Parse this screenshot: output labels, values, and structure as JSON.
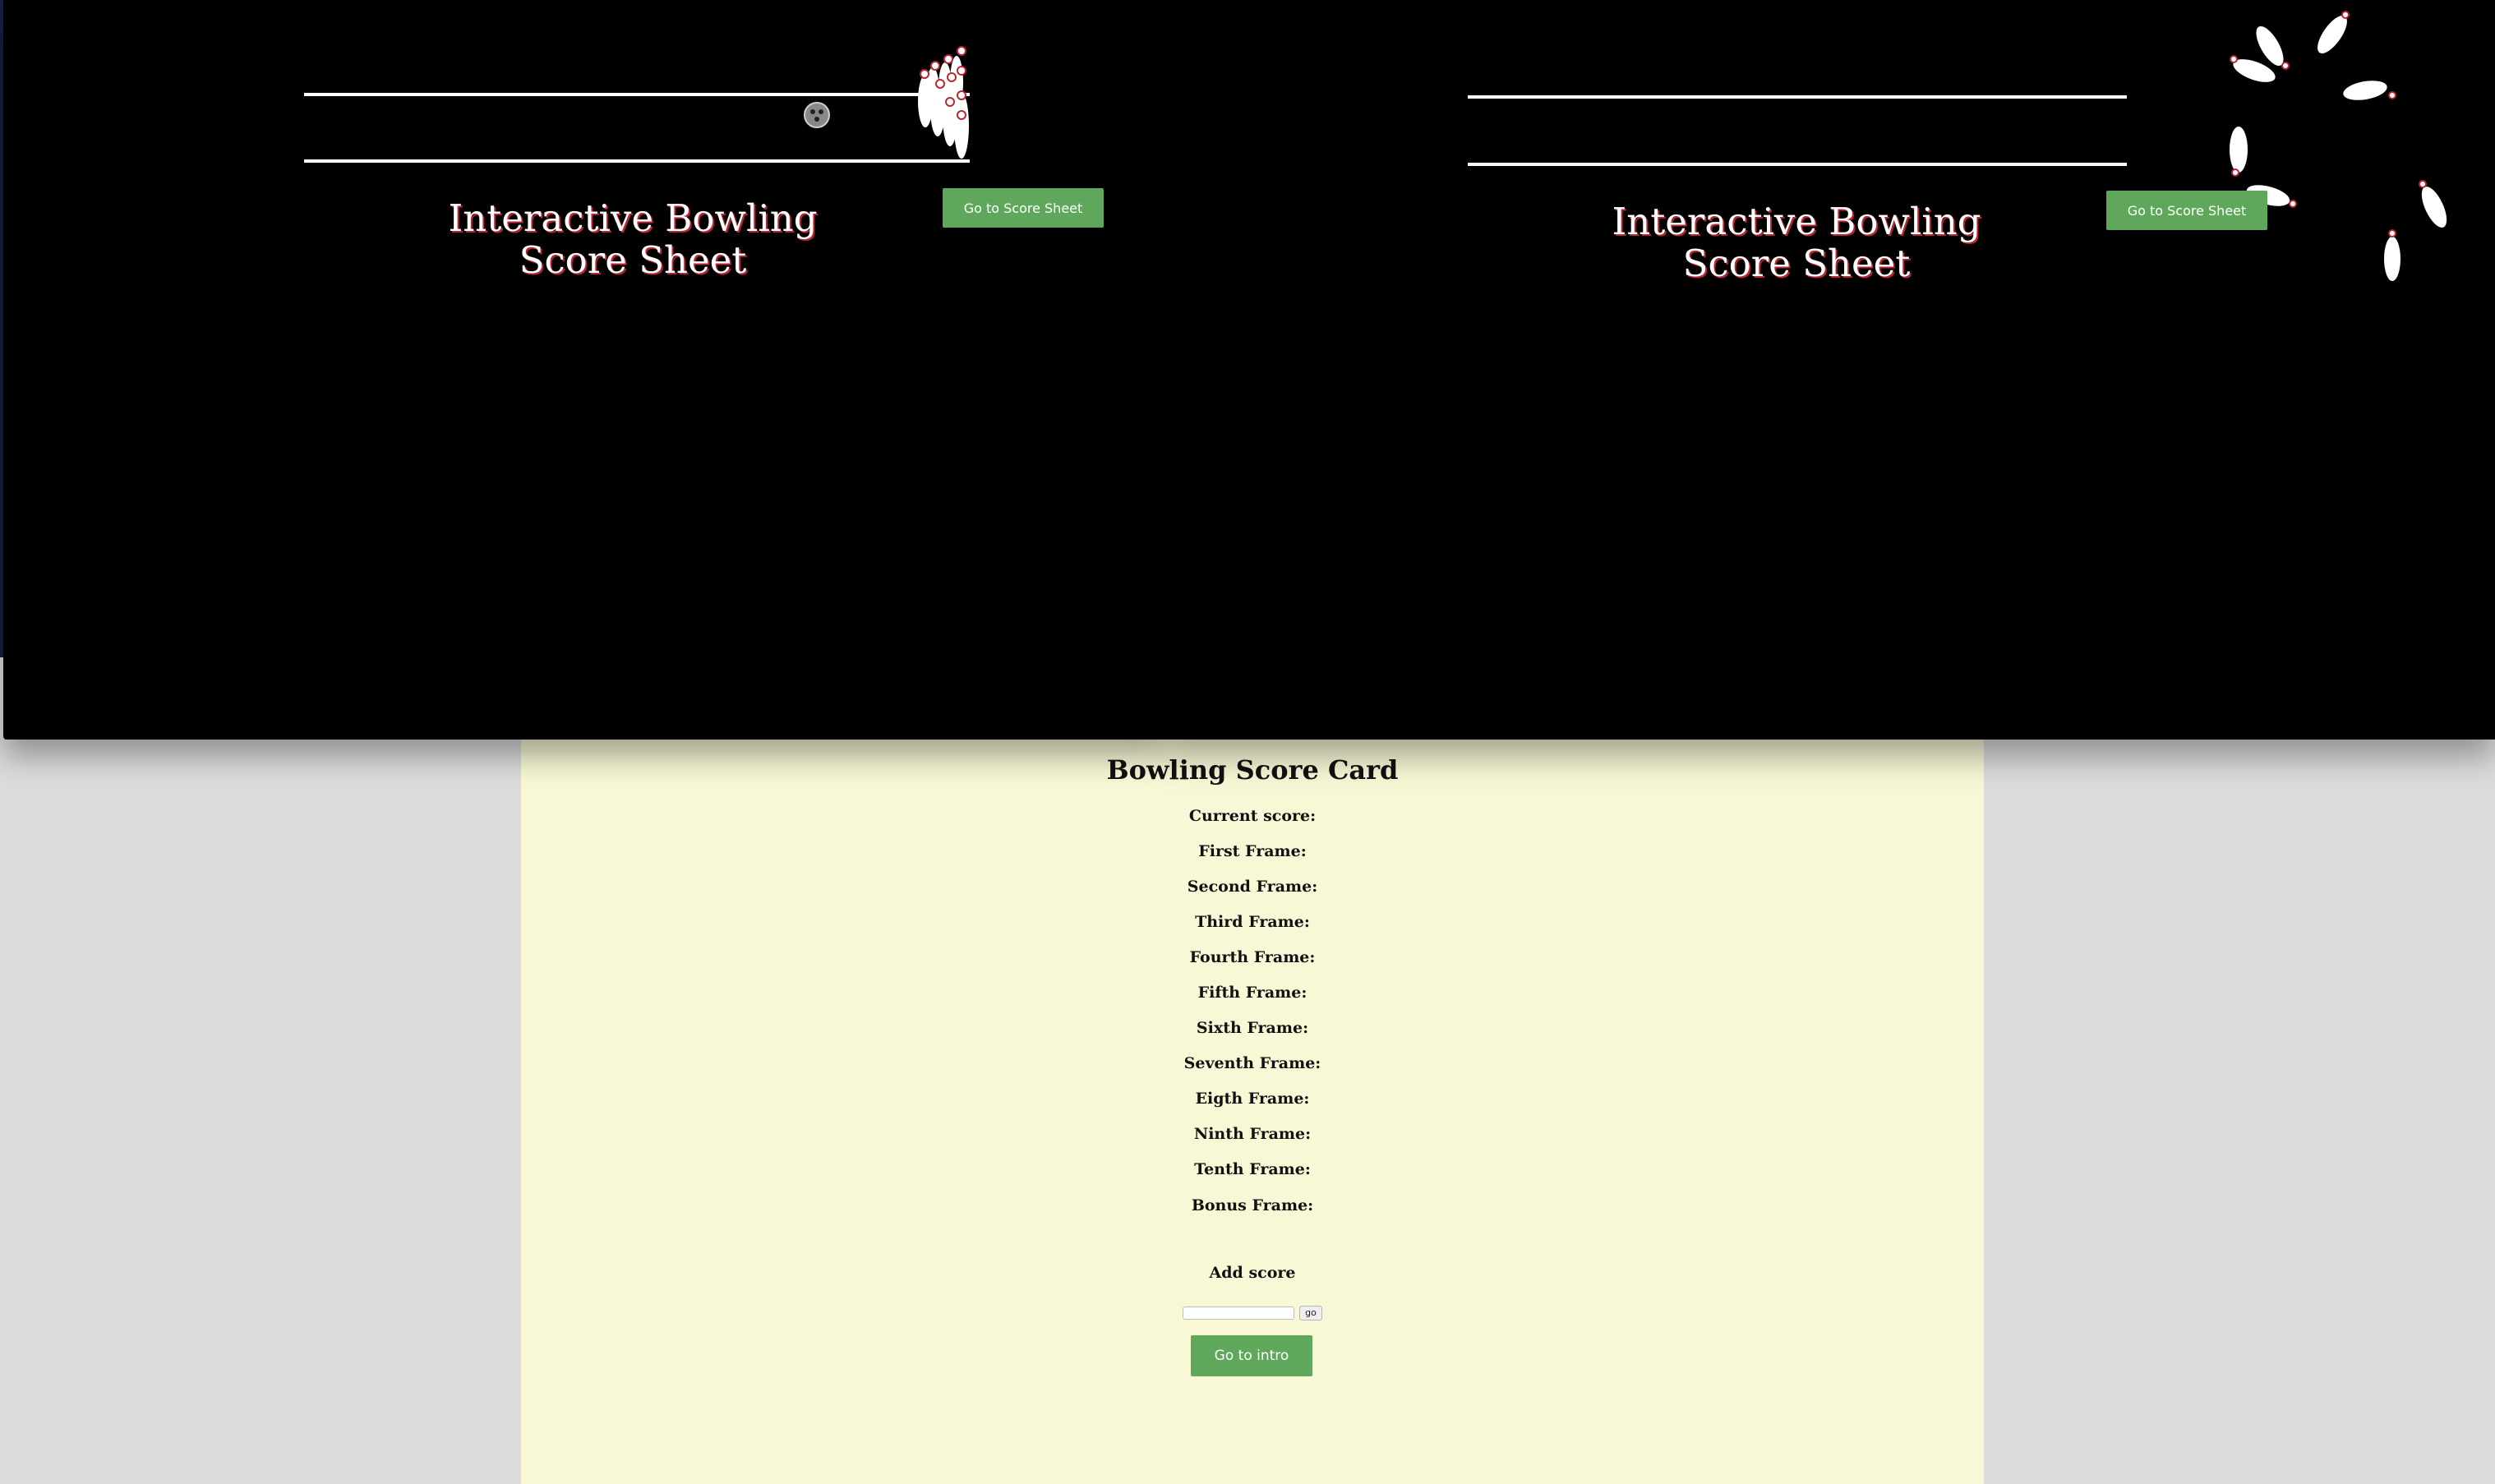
{
  "intro": {
    "title_line1": "Interactive Bowling",
    "title_line2": "Score Sheet",
    "score_sheet_button": "Go to Score Sheet",
    "background_color": "#000000",
    "title_shadow_color": "#b82632",
    "button_color": "#5fa75a"
  },
  "scorecard": {
    "title": "Bowling Score Card",
    "background_color": "#f8f8d6",
    "rows": [
      "Current score:",
      "First Frame:",
      "Second Frame:",
      "Third Frame:",
      "Fourth Frame:",
      "Fifth Frame:",
      "Sixth Frame:",
      "Seventh Frame:",
      "Eigth Frame:",
      "Ninth Frame:",
      "Tenth Frame:",
      "Bonus Frame:"
    ],
    "add_score_label": "Add score",
    "score_input_value": "",
    "go_button": "go",
    "intro_button": "Go to intro"
  },
  "icons": {
    "bowling_ball": "bowling-ball-icon",
    "pins_rack": "bowling-pins-icon",
    "scattered_pins": "scattered-pin-icon"
  }
}
